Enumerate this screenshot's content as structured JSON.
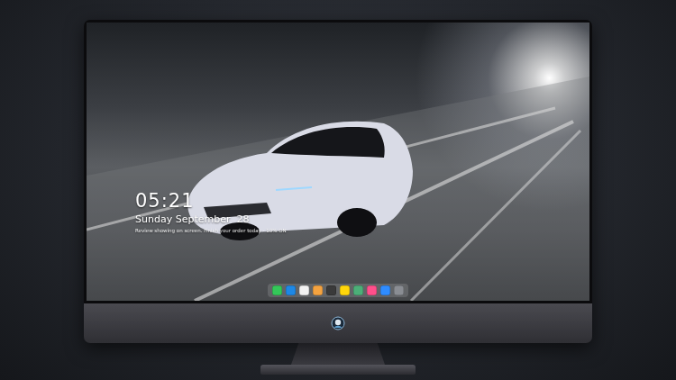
{
  "lockscreen": {
    "time": "05:21",
    "date": "Sunday September  28",
    "notice": "Review showing on screen. Finish your order today - 10% ON"
  },
  "dock": {
    "items": [
      {
        "color": "#34c759"
      },
      {
        "color": "#1e88e5"
      },
      {
        "color": "#f2f2f2"
      },
      {
        "color": "#f4a340"
      },
      {
        "color": "#3a3a3a"
      },
      {
        "color": "#ffd60a"
      },
      {
        "color": "#4caf78"
      },
      {
        "color": "#ff4f8b"
      },
      {
        "color": "#2f8cff"
      },
      {
        "color": "#8a8d93"
      }
    ]
  }
}
